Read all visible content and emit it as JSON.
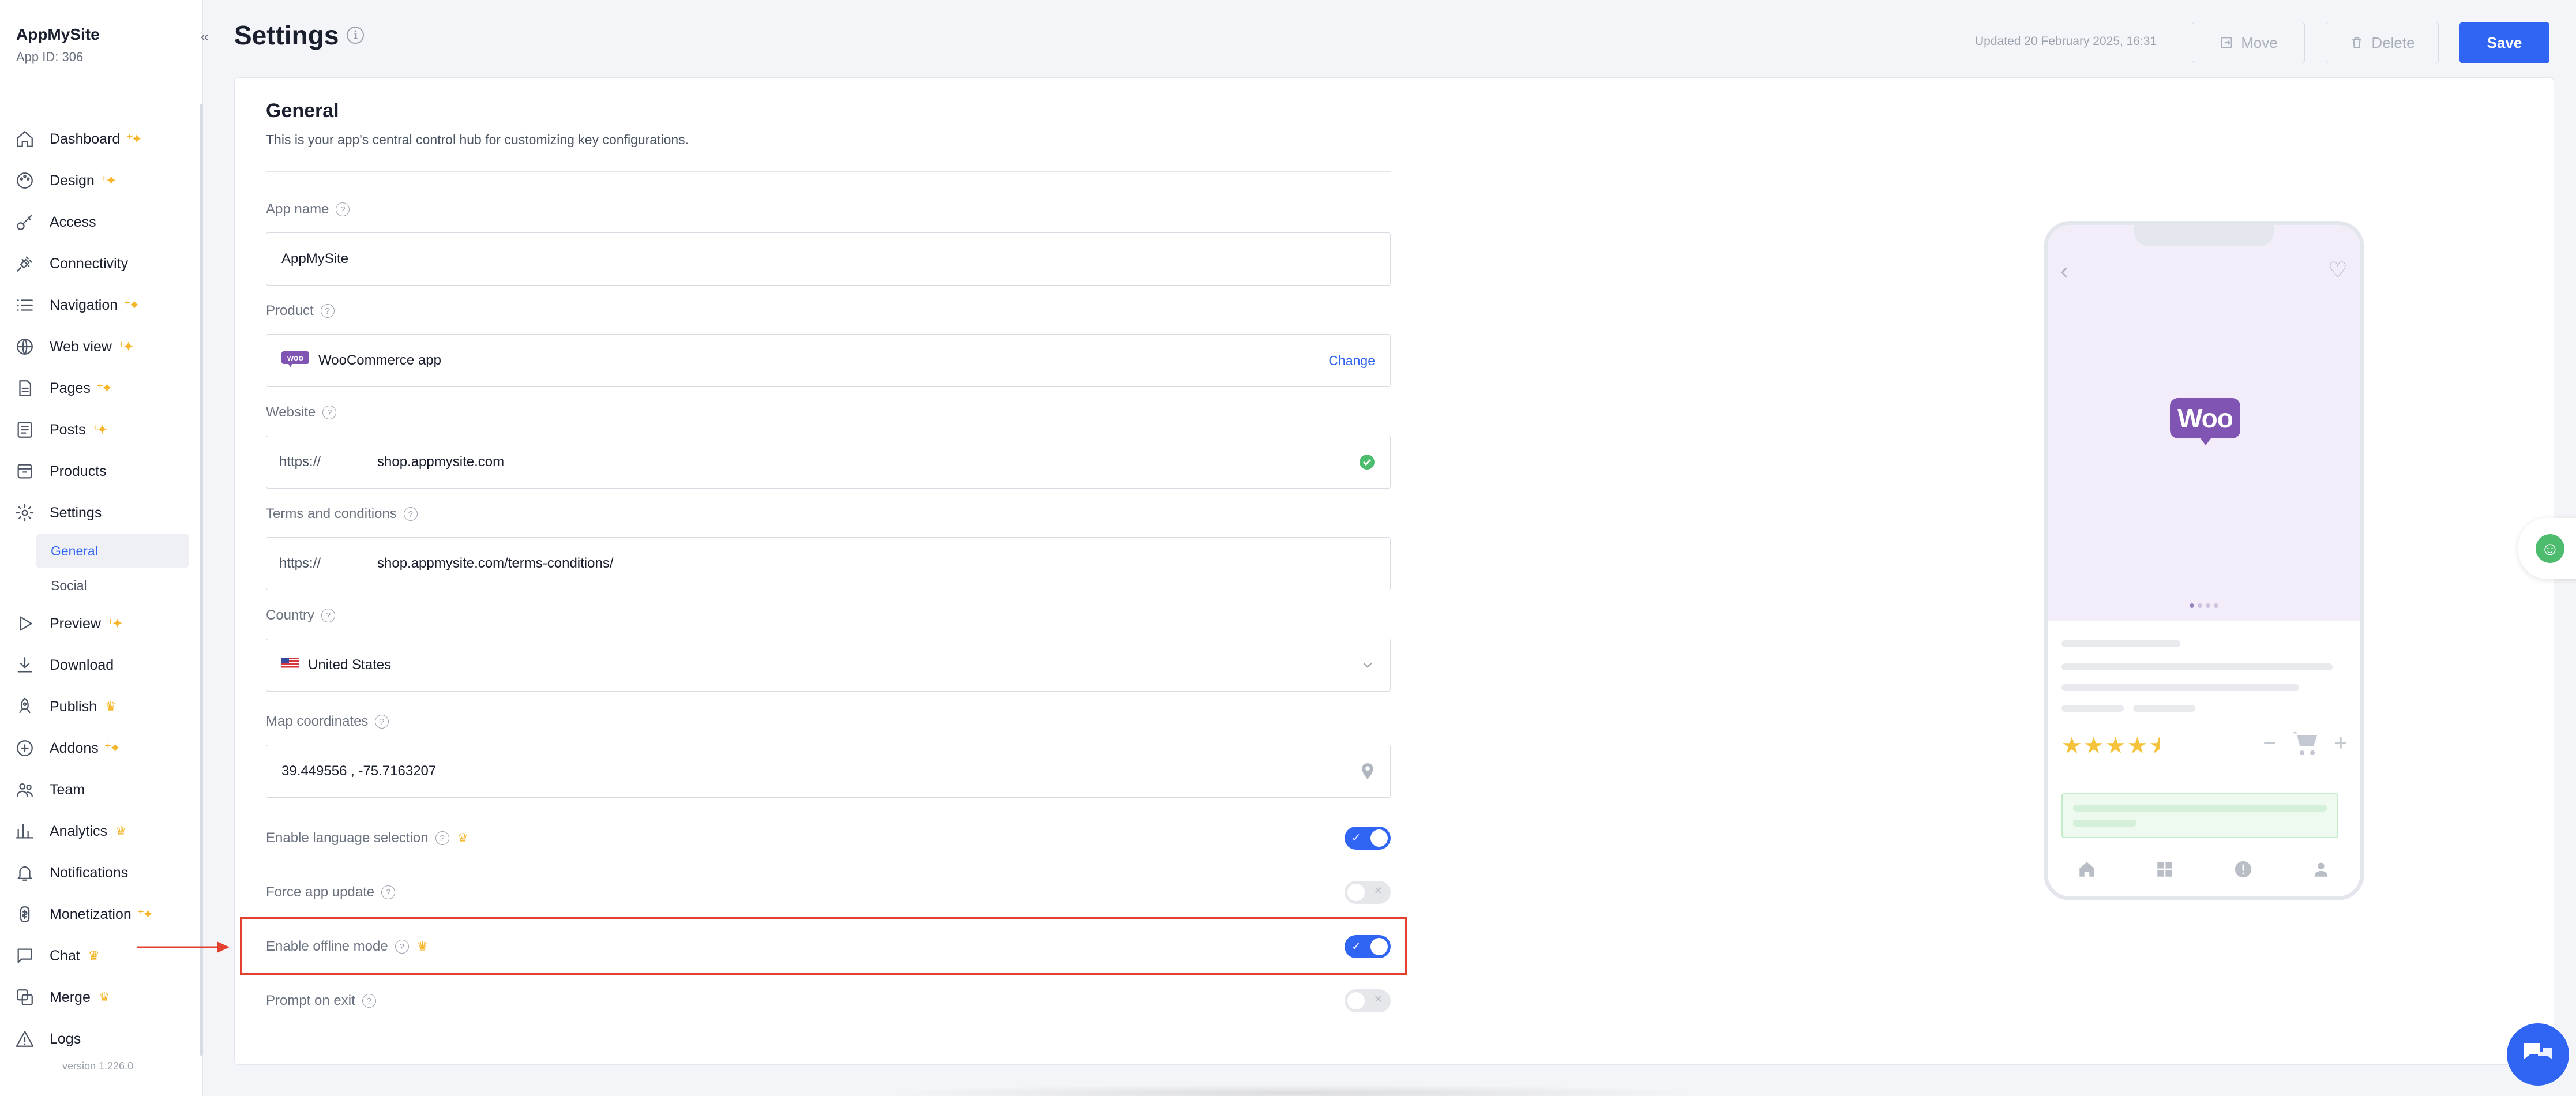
{
  "app": {
    "name": "AppMySite",
    "app_id": "App ID: 306",
    "version": "version 1.226.0"
  },
  "sidebar": {
    "items": [
      {
        "label": "Dashboard",
        "icon": "home-icon",
        "badge": "sparkle"
      },
      {
        "label": "Design",
        "icon": "palette-icon",
        "badge": "sparkle"
      },
      {
        "label": "Access",
        "icon": "key-icon",
        "badge": ""
      },
      {
        "label": "Connectivity",
        "icon": "plug-icon",
        "badge": ""
      },
      {
        "label": "Navigation",
        "icon": "list-icon",
        "badge": "sparkle"
      },
      {
        "label": "Web view",
        "icon": "globe-icon",
        "badge": "sparkle"
      },
      {
        "label": "Pages",
        "icon": "page-icon",
        "badge": "sparkle"
      },
      {
        "label": "Posts",
        "icon": "posts-icon",
        "badge": "sparkle"
      },
      {
        "label": "Products",
        "icon": "box-icon",
        "badge": ""
      },
      {
        "label": "Settings",
        "icon": "gear-icon",
        "badge": ""
      }
    ],
    "settings_sub": [
      {
        "label": "General",
        "active": true
      },
      {
        "label": "Social",
        "active": false
      }
    ],
    "items_after": [
      {
        "label": "Preview",
        "icon": "play-icon",
        "badge": "sparkle"
      },
      {
        "label": "Download",
        "icon": "download-icon",
        "badge": ""
      },
      {
        "label": "Publish",
        "icon": "rocket-icon",
        "badge": "crown"
      },
      {
        "label": "Addons",
        "icon": "plus-circle-icon",
        "badge": "sparkle"
      },
      {
        "label": "Team",
        "icon": "team-icon",
        "badge": ""
      },
      {
        "label": "Analytics",
        "icon": "chart-icon",
        "badge": "crown"
      },
      {
        "label": "Notifications",
        "icon": "bell-icon",
        "badge": ""
      },
      {
        "label": "Monetization",
        "icon": "money-icon",
        "badge": "sparkle"
      },
      {
        "label": "Chat",
        "icon": "chat-icon",
        "badge": "crown"
      },
      {
        "label": "Merge",
        "icon": "merge-icon",
        "badge": "crown"
      },
      {
        "label": "Logs",
        "icon": "warning-icon",
        "badge": ""
      }
    ]
  },
  "header": {
    "title": "Settings",
    "updated": "Updated 20 February 2025, 16:31",
    "move_label": "Move",
    "delete_label": "Delete",
    "save_label": "Save"
  },
  "general": {
    "title": "General",
    "subtitle": "This is your app's central control hub for customizing key configurations.",
    "app_name_label": "App name",
    "app_name_value": "AppMySite",
    "product_label": "Product",
    "product_value": "WooCommerce app",
    "product_change": "Change",
    "website_label": "Website",
    "website_prefix": "https://",
    "website_value": "shop.appmysite.com",
    "terms_label": "Terms and conditions",
    "terms_prefix": "https://",
    "terms_value": "shop.appmysite.com/terms-conditions/",
    "country_label": "Country",
    "country_value": "United States",
    "map_label": "Map coordinates",
    "map_value": "39.449556 , -75.7163207",
    "toggles": [
      {
        "label": "Enable language selection",
        "premium": true,
        "on": true
      },
      {
        "label": "Force app update",
        "premium": false,
        "on": false
      },
      {
        "label": "Enable offline mode",
        "premium": true,
        "on": true
      },
      {
        "label": "Prompt on exit",
        "premium": false,
        "on": false
      }
    ]
  },
  "preview": {
    "logo_text": "Woo",
    "rating": 4.5
  },
  "colors": {
    "accent": "#3064f2",
    "highlight": "#e3402f",
    "woo_purple": "#7f54b3"
  }
}
